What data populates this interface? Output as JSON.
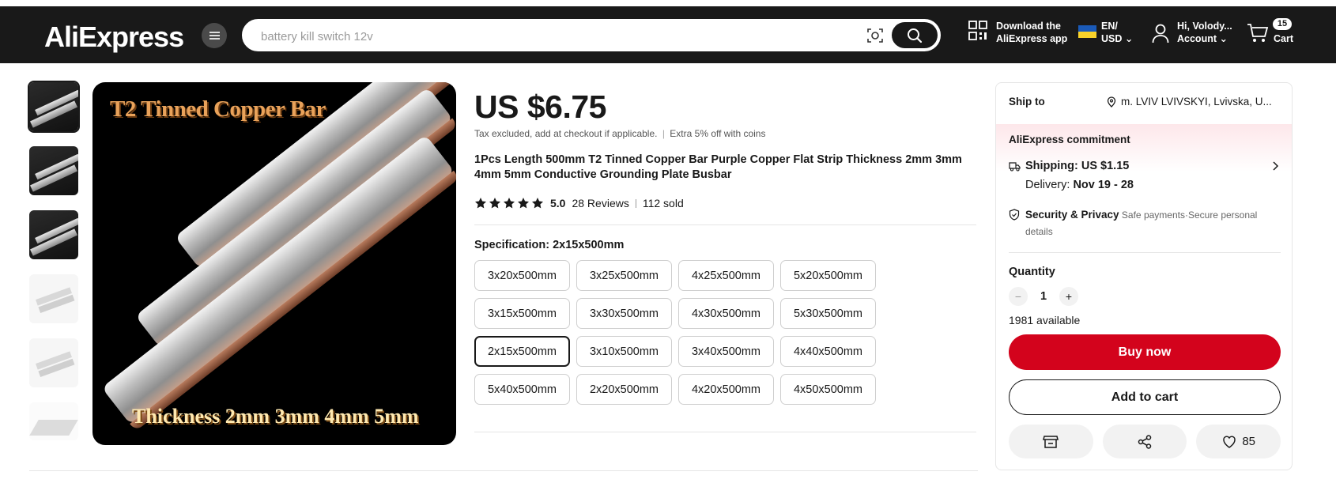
{
  "header": {
    "logo": "AliExpress",
    "search_placeholder": "battery kill switch 12v",
    "app_line1": "Download the",
    "app_line2": "AliExpress app",
    "lang": "EN/",
    "currency": "USD",
    "user_greeting": "Hi, Volody...",
    "account_label": "Account",
    "cart_label": "Cart",
    "cart_count": "15"
  },
  "product": {
    "price": "US $6.75",
    "tax_note": "Tax excluded, add at checkout if applicable.",
    "coins_note": "Extra 5% off with coins",
    "title": "1Pcs Length 500mm T2 Tinned Copper Bar Purple Copper Flat Strip Thickness 2mm 3mm 4mm 5mm Conductive Grounding Plate Busbar",
    "rating": "5.0",
    "reviews": "28 Reviews",
    "sold": "112 sold",
    "stars": 5,
    "image_title": "T2 Tinned Copper Bar",
    "image_subtitle": "Thickness 2mm 3mm 4mm 5mm",
    "specification_label": "Specification: 2x15x500mm",
    "spec_options": [
      "3x20x500mm",
      "3x25x500mm",
      "4x25x500mm",
      "5x20x500mm",
      "3x15x500mm",
      "3x30x500mm",
      "4x30x500mm",
      "5x30x500mm",
      "2x15x500mm",
      "3x10x500mm",
      "3x40x500mm",
      "4x40x500mm",
      "5x40x500mm",
      "2x20x500mm",
      "4x20x500mm",
      "4x50x500mm"
    ],
    "selected_spec": "2x15x500mm"
  },
  "panel": {
    "ship_to_label": "Ship to",
    "ship_to_value": "m. LVIV LVIVSKYI, Lvivska, U...",
    "commitment": "AliExpress commitment",
    "shipping": "Shipping: US $1.15",
    "delivery_label": "Delivery:",
    "delivery_dates": "Nov 19 - 28",
    "security_title": "Security & Privacy",
    "security_text": "Safe payments·Secure personal details",
    "quantity_label": "Quantity",
    "quantity_value": "1",
    "available": "1981 available",
    "buy_now": "Buy now",
    "add_to_cart": "Add to cart",
    "wishlist_count": "85"
  },
  "colors": {
    "header_bg": "#191919",
    "buy_red": "#d3031c",
    "flag_blue": "#1a5ab8",
    "flag_yellow": "#f8d22a"
  },
  "icons": [
    "menu-icon",
    "camera-icon",
    "search-icon",
    "qr-code-icon",
    "user-icon",
    "cart-icon",
    "star-icon",
    "location-pin-icon",
    "truck-icon",
    "chevron-right-icon",
    "shield-icon",
    "store-icon",
    "share-icon",
    "heart-icon"
  ]
}
